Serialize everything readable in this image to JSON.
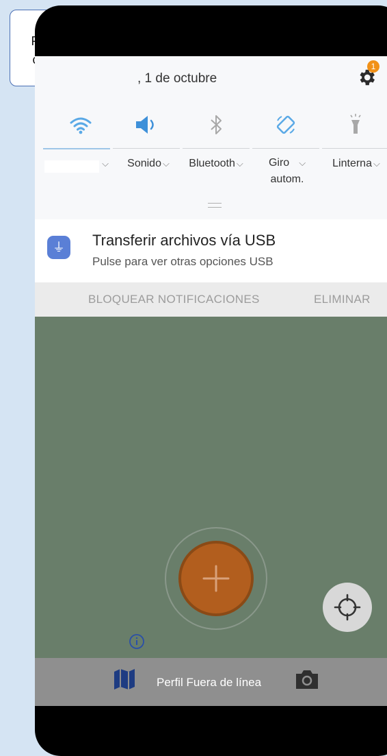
{
  "tooltip": {
    "line1": "Prende el WiFi y",
    "line2": "conecta a la red"
  },
  "status": {
    "date": ", 1 de octubre",
    "settings_badge": "1"
  },
  "quick_settings": [
    {
      "label": "",
      "icon": "wifi-icon"
    },
    {
      "label": "Sonido",
      "icon": "volume-icon"
    },
    {
      "label": "Bluetooth",
      "icon": "bluetooth-icon"
    },
    {
      "label": "Giro",
      "label2": "autom.",
      "icon": "rotation-icon"
    },
    {
      "label": "Linterna",
      "icon": "flashlight-icon"
    }
  ],
  "notification": {
    "title": "Transferir archivos vía USB",
    "subtitle": "Pulse para ver otras opciones USB",
    "actions": [
      "BLOQUEAR NOTIFICACIONES",
      "ELIMINAR"
    ]
  },
  "bottom_bar": {
    "label": "Perfil Fuera de línea"
  },
  "colors": {
    "accent": "#3e90d9",
    "fab": "#b25e1e",
    "map": "#697e6a",
    "badge": "#f19118"
  }
}
